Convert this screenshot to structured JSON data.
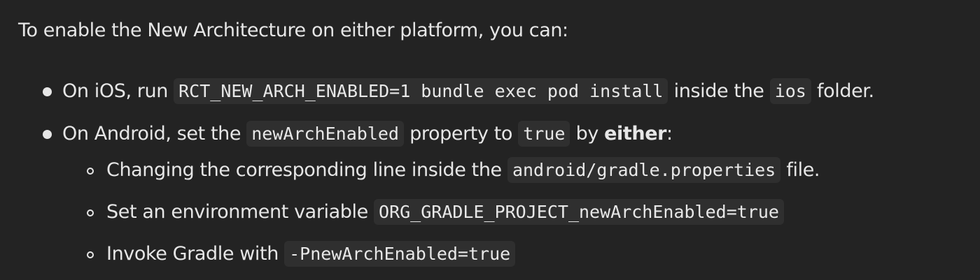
{
  "intro": "To enable the New Architecture on either platform, you can:",
  "items": [
    {
      "before": "On iOS, run ",
      "code1": "RCT_NEW_ARCH_ENABLED=1 bundle exec pod install",
      "middle": " inside the ",
      "code2": "ios",
      "after": " folder."
    },
    {
      "before": "On Android, set the ",
      "code1": "newArchEnabled",
      "middle": " property to ",
      "code2": "true",
      "middle2": " by ",
      "emph": "either",
      "after": ":",
      "subitems": [
        {
          "before": "Changing the corresponding line inside the ",
          "code": "android/gradle.properties",
          "after": " file."
        },
        {
          "before": "Set an environment variable ",
          "code": "ORG_GRADLE_PROJECT_newArchEnabled=true",
          "after": ""
        },
        {
          "before": "Invoke Gradle with ",
          "code": "-PnewArchEnabled=true",
          "after": ""
        }
      ]
    }
  ]
}
